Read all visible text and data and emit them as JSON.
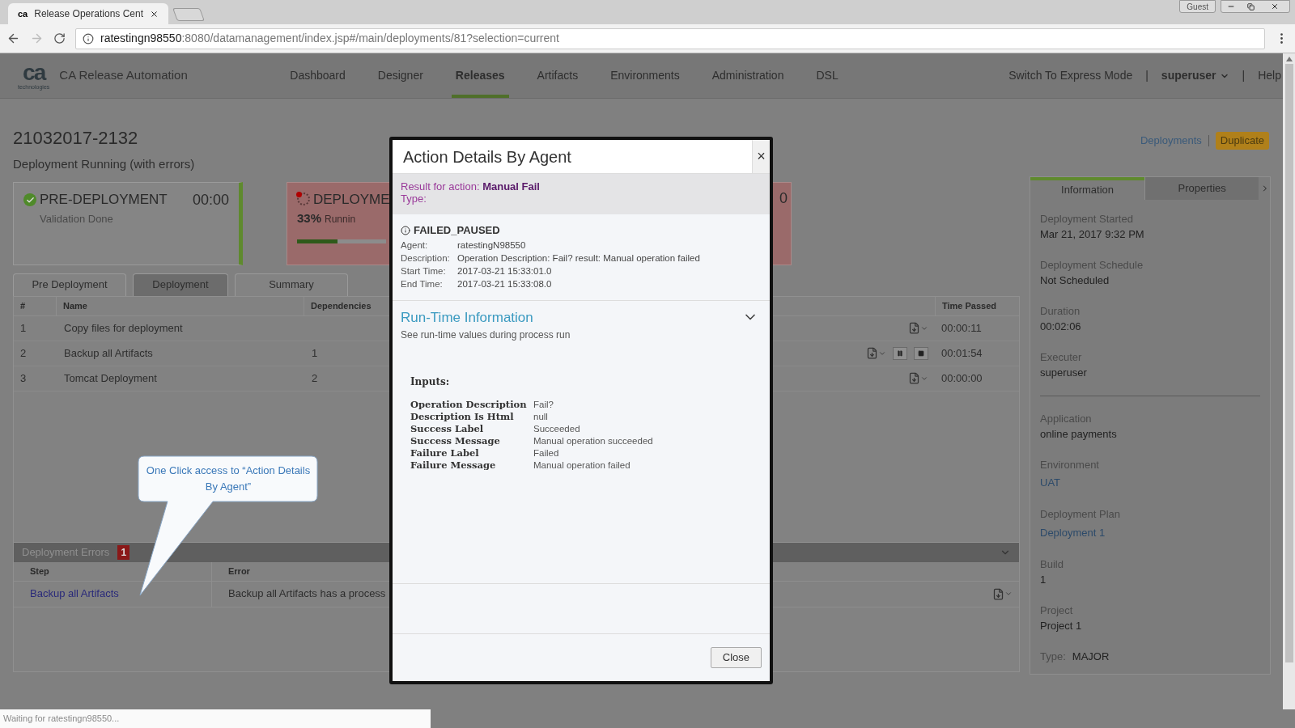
{
  "browser": {
    "favicon": "ca",
    "tab_title": "Release Operations Cent",
    "profile": "Guest",
    "url_host": "ratestingn98550",
    "url_path": ":8080/datamanagement/index.jsp#/main/deployments/81?selection=current"
  },
  "app": {
    "logo_mark": "ca",
    "logo_sub": "technologies",
    "brand": "CA Release Automation",
    "nav": [
      {
        "label": "Dashboard",
        "selected": false
      },
      {
        "label": "Designer",
        "selected": false
      },
      {
        "label": "Releases",
        "selected": true
      },
      {
        "label": "Artifacts",
        "selected": false
      },
      {
        "label": "Environments",
        "selected": false
      },
      {
        "label": "Administration",
        "selected": false
      },
      {
        "label": "DSL",
        "selected": false
      }
    ],
    "express_mode": "Switch To Express Mode",
    "separator": "|",
    "user": "superuser",
    "help": "Help"
  },
  "deployment": {
    "id": "21032017-2132",
    "status": "Deployment Running (with errors)",
    "deployments_link": "Deployments",
    "duplicate_button": "Duplicate",
    "stages": [
      {
        "kind": "done",
        "title": "PRE-DEPLOYMENT",
        "time": "00:00",
        "subtitle": "Validation Done"
      },
      {
        "kind": "running",
        "title": "DEPLOYME",
        "percent": "33%",
        "subtitle": "Runnin",
        "level": 0.45,
        "time": "0"
      }
    ],
    "tabs": [
      {
        "label": "Pre Deployment",
        "selected": false
      },
      {
        "label": "Deployment",
        "selected": true
      },
      {
        "label": "Summary",
        "selected": false
      }
    ],
    "table": {
      "columns": [
        "#",
        "Name",
        "Dependencies",
        "Time Passed"
      ],
      "rows": [
        {
          "number": "1",
          "name": "Copy files for deployment",
          "dependencies": "",
          "time": "00:00:11",
          "controls": false
        },
        {
          "number": "2",
          "name": "Backup all Artifacts",
          "dependencies": "1",
          "time": "00:01:54",
          "controls": true
        },
        {
          "number": "3",
          "name": "Tomcat Deployment",
          "dependencies": "2",
          "time": "00:00:00",
          "controls": false
        }
      ]
    },
    "errors": {
      "title": "Deployment Errors",
      "count": "1",
      "columns": [
        "Step",
        "Error"
      ],
      "rows": [
        {
          "step": "Backup all Artifacts",
          "error": "Backup all Artifacts has a process"
        }
      ]
    }
  },
  "callout": "One Click access to “Action Details By Agent”",
  "info_panel": {
    "tabs": [
      {
        "label": "Information",
        "selected": true
      },
      {
        "label": "Properties",
        "selected": false
      }
    ],
    "groups": [
      [
        {
          "kind": "text",
          "label": "Deployment Started",
          "value": "Mar 21, 2017 9:32 PM"
        },
        {
          "kind": "text",
          "label": "Deployment Schedule",
          "value": "Not Scheduled"
        },
        {
          "kind": "text",
          "label": "Duration",
          "value": "00:02:06"
        },
        {
          "kind": "text",
          "label": "Executer",
          "value": "superuser"
        }
      ],
      [
        {
          "kind": "text",
          "label": "Application",
          "value": "online payments"
        },
        {
          "kind": "link",
          "label": "Environment",
          "value": "UAT"
        },
        {
          "kind": "link",
          "label": "Deployment Plan",
          "value": "Deployment 1"
        },
        {
          "kind": "text",
          "label": "Build",
          "value": "1"
        },
        {
          "kind": "text",
          "label": "Project",
          "value": "Project 1"
        },
        {
          "kind": "inline",
          "label": "Type:",
          "value": "MAJOR"
        }
      ]
    ]
  },
  "modal": {
    "title": "Action Details By Agent",
    "close_glyph": "×",
    "result_label": "Result for action:",
    "result_value": "Manual Fail",
    "type_label": "Type:",
    "status": "FAILED_PAUSED",
    "details": [
      {
        "label": "Agent:",
        "value": "ratestingN98550"
      },
      {
        "label": "Description:",
        "value": "Operation Description: Fail? result: Manual operation failed"
      },
      {
        "label": "Start Time:",
        "value": "2017-03-21 15:33:01.0"
      },
      {
        "label": "End Time:",
        "value": "2017-03-21 15:33:08.0"
      }
    ],
    "runtime": {
      "title": "Run-Time Information",
      "subtitle": "See run-time values during process run",
      "expanded": true,
      "inputs_title": "Inputs:",
      "inputs": [
        {
          "name": "Operation Description",
          "value": "Fail?"
        },
        {
          "name": "Description Is Html",
          "value": "null"
        },
        {
          "name": "Success Label",
          "value": "Succeeded"
        },
        {
          "name": "Success Message",
          "value": "Manual operation succeeded"
        },
        {
          "name": "Failure Label",
          "value": "Failed"
        },
        {
          "name": "Failure Message",
          "value": "Manual operation failed"
        }
      ]
    },
    "close_button": "Close"
  },
  "status_bar": "Waiting for ratestingn98550..."
}
